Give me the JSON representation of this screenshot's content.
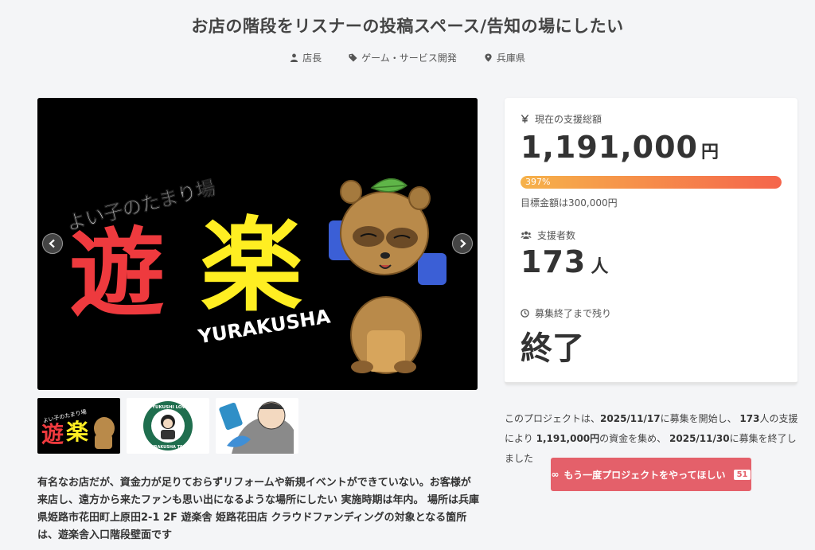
{
  "project": {
    "title": "お店の階段をリスナーの投稿スペース/告知の場にしたい",
    "meta": [
      {
        "icon": "person-icon",
        "label": "店長"
      },
      {
        "icon": "tag-icon",
        "label": "ゲーム・サービス開発"
      },
      {
        "icon": "location-pin-icon",
        "label": "兵庫県"
      }
    ]
  },
  "hero": {
    "tagline": "よい子のたまり場",
    "logo_char_1": "遊",
    "logo_char_2": "楽",
    "logo_roman": "YURAKUSHA"
  },
  "thumbnails": {
    "thumb2_top": "YUKUSHI LOVERS",
    "thumb2_bottom": "YURAKUSHA TENBURA"
  },
  "description": "有名なお店だが、資金力が足りておらずリフォームや新規イベントができていない。お客様が来店し、遠方から来たファンも思い出になるような場所にしたい 実施時期は年内。 場所は兵庫県姫路市花田町上原田2-1 2F 遊楽舎 姫路花田店 クラウドファンディングの対象となる箇所は、遊楽舎入口階段壁面です",
  "stats": {
    "total_label": "現在の支援総額",
    "total_value": "1,191,000",
    "yen_unit": "円",
    "percent_text": "397%",
    "progress_fraction": 1.0,
    "goal_text": "目標金額は300,000円",
    "backers_label": "支援者数",
    "backers_value": "173",
    "backers_unit": "人",
    "remaining_label": "募集終了まで残り",
    "remaining_value": "終了"
  },
  "summary": {
    "p1": "このプロジェクトは、",
    "start_date": "2025/11/17",
    "p2": "に募集を開始し、",
    "backers": "173",
    "p3": "人の支援により",
    "amount": "1,191,000円",
    "p4": "の資金を集め、",
    "end_date": "2025/11/30",
    "p5": "に募集を終了しました"
  },
  "again_button": {
    "label": "もう一度プロジェクトをやってほしい",
    "count": "51"
  },
  "colors": {
    "accent": "#e4606a",
    "progress_start": "#f6b24a",
    "progress_end": "#f5654b"
  }
}
